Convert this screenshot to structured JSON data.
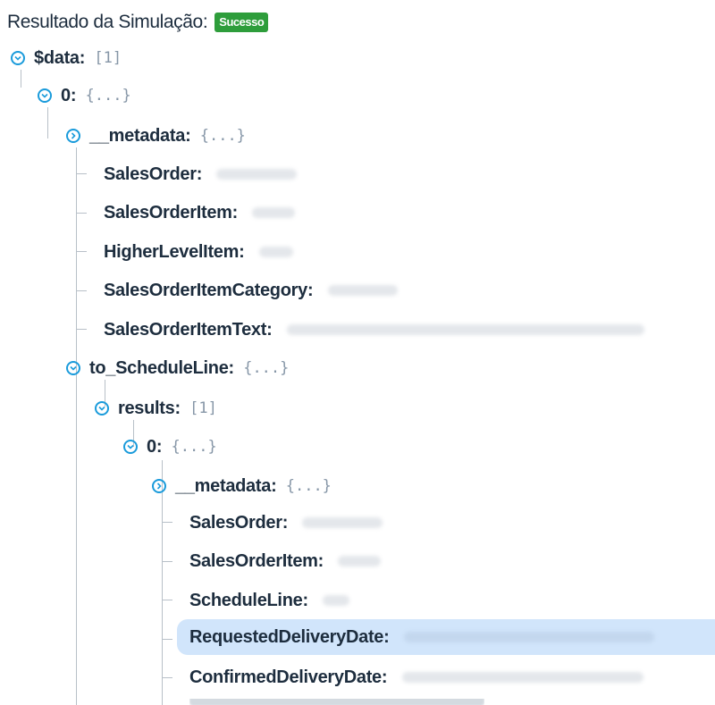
{
  "header": {
    "title": "Resultado da Simulação:",
    "status": "Sucesso"
  },
  "tree": {
    "root": {
      "key": "$data",
      "meta": "[1]"
    },
    "item0": {
      "key": "0",
      "meta": "{...}"
    },
    "metadata1": {
      "key": "__metadata",
      "meta": "{...}"
    },
    "salesOrder": {
      "key": "SalesOrder"
    },
    "salesOrderItem": {
      "key": "SalesOrderItem"
    },
    "higherLevelItem": {
      "key": "HigherLevelItem"
    },
    "salesOrderItemCategory": {
      "key": "SalesOrderItemCategory"
    },
    "salesOrderItemText": {
      "key": "SalesOrderItemText"
    },
    "toScheduleLine": {
      "key": "to_ScheduleLine",
      "meta": "{...}"
    },
    "results": {
      "key": "results",
      "meta": "[1]"
    },
    "resultsItem0": {
      "key": "0",
      "meta": "{...}"
    },
    "metadata2": {
      "key": "__metadata",
      "meta": "{...}"
    },
    "slSalesOrder": {
      "key": "SalesOrder"
    },
    "slSalesOrderItem": {
      "key": "SalesOrderItem"
    },
    "scheduleLine": {
      "key": "ScheduleLine"
    },
    "requestedDeliveryDate": {
      "key": "RequestedDeliveryDate"
    },
    "confirmedDeliveryDate": {
      "key": "ConfirmedDeliveryDate"
    }
  },
  "colors": {
    "accent": "#1a9bdb",
    "success": "#2e9d3b",
    "selection": "#d1e5fb"
  }
}
